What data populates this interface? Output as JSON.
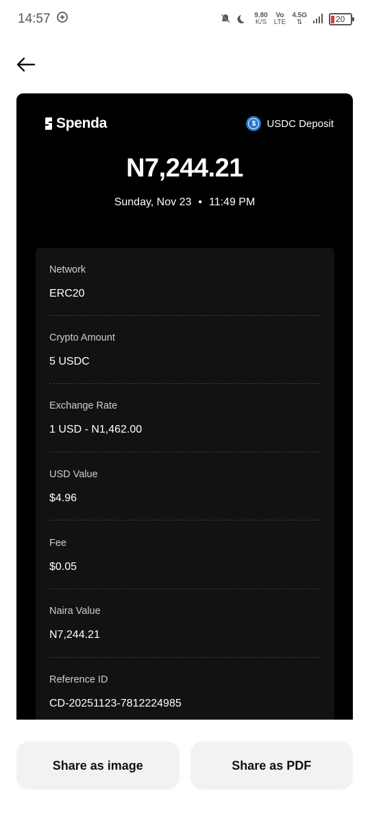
{
  "status_bar": {
    "time": "14:57",
    "speed_value": "9.80",
    "speed_unit": "K/S",
    "vo": "Vo",
    "lte": "LTE",
    "network": "4.5G",
    "battery": "20",
    "colors": {
      "battery_low": "#e53935"
    }
  },
  "header": {
    "back_icon": "arrow-left-icon"
  },
  "receipt": {
    "brand": "Spenda",
    "tag": "USDC Deposit",
    "amount": "N7,244.21",
    "date": "Sunday, Nov 23",
    "separator": "•",
    "time": "11:49 PM",
    "details": [
      {
        "label": "Network",
        "value": "ERC20"
      },
      {
        "label": "Crypto Amount",
        "value": "5 USDC"
      },
      {
        "label": "Exchange Rate",
        "value": "1 USD - N1,462.00"
      },
      {
        "label": "USD Value",
        "value": "$4.96"
      },
      {
        "label": "Fee",
        "value": "$0.05"
      },
      {
        "label": "Naira Value",
        "value": "N7,244.21"
      },
      {
        "label": "Reference ID",
        "value": "CD-20251123-7812224985"
      }
    ],
    "colors": {
      "background": "#000000",
      "panel": "#121212",
      "usdc": "#2775ca"
    }
  },
  "actions": {
    "share_image": "Share as image",
    "share_pdf": "Share as PDF"
  }
}
